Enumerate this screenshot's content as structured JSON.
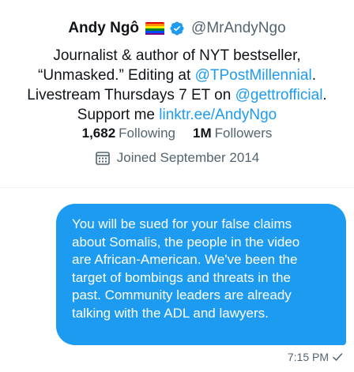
{
  "profile": {
    "name": "Andy Ngô",
    "handle": "@MrAndyNgo",
    "bio": {
      "line1": "Journalist & author of NYT bestseller,",
      "line2_pre": "“Unmasked.” Editing at ",
      "line2_link": "@TPostMillennial",
      "line2_post": ".",
      "line3_pre": "Livestream Thursdays 7 ET on ",
      "line3_link": "@gettrofficial",
      "line3_post": ".",
      "line4_pre": "Support me ",
      "line4_link": "linktr.ee/AndyNgo"
    },
    "following_count": "1,682",
    "following_label": "Following",
    "followers_count": "1M",
    "followers_label": "Followers",
    "joined": "Joined September 2014"
  },
  "message": {
    "lines": [
      "You will be sued for your false claims",
      "about Somalis, the people in the video",
      "are African-American. We've been the",
      "target of bombings and threats in the",
      "past. Community leaders are already",
      "talking with the ADL and lawyers."
    ],
    "time": "7:15 PM"
  },
  "colors": {
    "accent": "#1d9bf0",
    "text": "#0f1419",
    "secondary": "#536471"
  },
  "icons": {
    "flag": "rainbow-flag-icon",
    "verified": "verified-badge-icon",
    "calendar": "calendar-icon",
    "sent": "checkmark-icon"
  }
}
